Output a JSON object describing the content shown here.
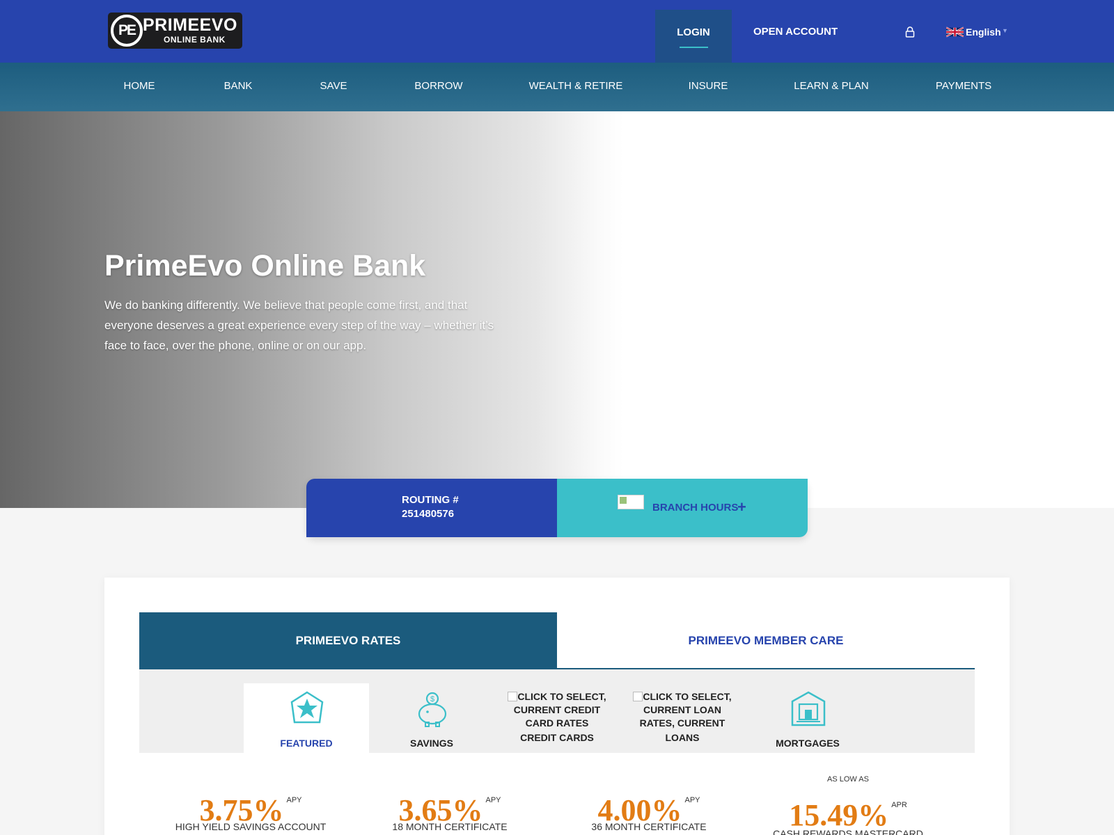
{
  "header": {
    "logo": {
      "mark": "PE",
      "name": "PRIMEEVO",
      "sub": "ONLINE BANK"
    },
    "login_label": "LOGIN",
    "open_account_label": "OPEN ACCOUNT",
    "language": "English",
    "language_caret": "▼"
  },
  "nav": {
    "items": [
      "HOME",
      "BANK",
      "SAVE",
      "BORROW",
      "WEALTH & RETIRE",
      "INSURE",
      "LEARN & PLAN",
      "PAYMENTS"
    ]
  },
  "hero": {
    "title": "PrimeEvo Online Bank",
    "text": "We do banking differently. We believe that people come first, and that everyone deserves a great experience every step of the way – whether it’s face to face, over the phone, online or on our app."
  },
  "info": {
    "routing_label": "ROUTING #",
    "routing_number": "251480576",
    "branch_label": "BRANCH HOURS",
    "branch_plus": "+"
  },
  "tabs": {
    "rates": "PRIMEEVO RATES",
    "care": "PRIMEEVO MEMBER CARE"
  },
  "categories": [
    {
      "label": "FEATURED",
      "icon": "star-icon",
      "active": true
    },
    {
      "label": "SAVINGS",
      "icon": "piggy-bank-icon",
      "active": false
    },
    {
      "alt": "CLICK TO SELECT, CURRENT CREDIT CARD RATES",
      "label": "CREDIT CARDS",
      "icon": "broken-image-icon",
      "active": false
    },
    {
      "alt": "CLICK TO SELECT, CURRENT LOAN RATES, CURRENT",
      "label": "LOANS",
      "icon": "broken-image-icon",
      "active": false
    },
    {
      "label": "MORTGAGES",
      "icon": "house-icon",
      "active": false
    }
  ],
  "rates": [
    {
      "prefix": "",
      "value": "3.75%",
      "unit": "APY",
      "name": "HIGH YIELD SAVINGS ACCOUNT"
    },
    {
      "prefix": "",
      "value": "3.65%",
      "unit": "APY",
      "name": "18 MONTH CERTIFICATE"
    },
    {
      "prefix": "",
      "value": "4.00%",
      "unit": "APY",
      "name": "36 MONTH CERTIFICATE"
    },
    {
      "prefix": "AS LOW AS",
      "value": "15.49%",
      "unit": "APR",
      "name": "CASH REWARDS MASTERCARD"
    }
  ],
  "colors": {
    "brand_blue": "#2744ad",
    "nav_teal": "#1d5d7f",
    "accent_cyan": "#3bbfc9",
    "rate_orange": "#e27c14"
  }
}
